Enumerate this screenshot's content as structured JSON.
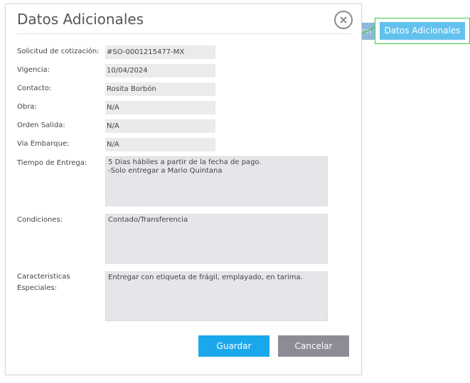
{
  "background": {
    "button_fragment": "on"
  },
  "callout": {
    "button_label": "Datos Adicionales"
  },
  "modal": {
    "title": "Datos Adicionales",
    "close_icon": "close-icon",
    "fields": [
      {
        "label": "Solicitud de cotización:",
        "value": "#SO-0001215477-MX"
      },
      {
        "label": "Vigencia:",
        "value": "10/04/2024"
      },
      {
        "label": "Contacto:",
        "value": "Rosita Borbón"
      },
      {
        "label": "Obra:",
        "value": "N/A"
      },
      {
        "label": "Orden Salida:",
        "value": "N/A"
      },
      {
        "label": "Via Embarque:",
        "value": "N/A"
      }
    ],
    "tiempo_entrega": {
      "label": "Tiempo de Entrega:",
      "value": "5 Dias hábiles a partir de la fecha de pago.\n-Solo entregar a Mario Quintana"
    },
    "condiciones": {
      "label": "Condiciones:",
      "value": "Contado/Transferencia"
    },
    "caracteristicas": {
      "label_line1": "Caracteristicas",
      "label_line2": "Especiales:",
      "value": "Entregar con etiqueta de frágil, emplayado, en tarima."
    },
    "buttons": {
      "save_label": "Guardar",
      "cancel_label": "Cancelar"
    }
  },
  "colors": {
    "save": "#1aa7ec",
    "cancel": "#8e8b96",
    "callout_border": "#3dcc3d",
    "callout_button": "#63c1ee"
  }
}
